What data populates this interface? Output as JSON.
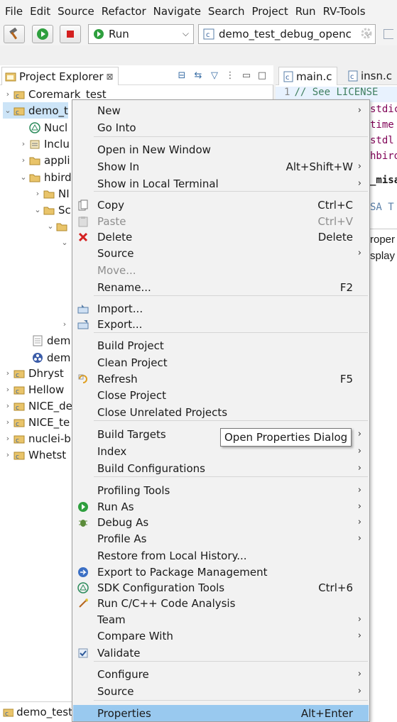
{
  "menubar": [
    "File",
    "Edit",
    "Source",
    "Refactor",
    "Navigate",
    "Search",
    "Project",
    "Run",
    "RV-Tools"
  ],
  "toolbar": {
    "run_mode": "Run",
    "launch_config": "demo_test_debug_openc"
  },
  "explorer": {
    "title": "Project Explorer",
    "close_glyph": "⊠",
    "tree": [
      {
        "label": "Coremark_test"
      },
      {
        "label": "demo_t"
      },
      {
        "label": "Nucl"
      },
      {
        "label": "Inclu"
      },
      {
        "label": "appli"
      },
      {
        "label": "hbird"
      },
      {
        "label": "NI"
      },
      {
        "label": "Sc"
      },
      {
        "label": "dem"
      },
      {
        "label": "dem"
      },
      {
        "label": "Dhryst"
      },
      {
        "label": "Hellow"
      },
      {
        "label": "NICE_de"
      },
      {
        "label": "NICE_te"
      },
      {
        "label": "nuclei-b"
      },
      {
        "label": "Whetst"
      }
    ]
  },
  "editor": {
    "tabs": [
      "main.c",
      "insn.c"
    ],
    "line_number": "1",
    "code_lines": [
      "// See LICENSE",
      "stdic",
      "time",
      "stdl",
      "hbird",
      "_misa",
      "SA T"
    ],
    "panel_lines": [
      "roper",
      "splay"
    ]
  },
  "bottombar": {
    "label": "demo_test"
  },
  "context_menu": {
    "items": [
      {
        "label": "New",
        "accel": "",
        "submenu": true
      },
      {
        "label": "Go Into",
        "accel": ""
      },
      {
        "label": "Open in New Window",
        "accel": ""
      },
      {
        "label": "Show In",
        "accel": "Alt+Shift+W",
        "submenu": true
      },
      {
        "label": "Show in Local Terminal",
        "accel": "",
        "submenu": true
      },
      {
        "label": "Copy",
        "accel": "Ctrl+C"
      },
      {
        "label": "Paste",
        "accel": "Ctrl+V"
      },
      {
        "label": "Delete",
        "accel": "Delete"
      },
      {
        "label": "Source",
        "accel": "",
        "submenu": true
      },
      {
        "label": "Move...",
        "accel": ""
      },
      {
        "label": "Rename...",
        "accel": "F2"
      },
      {
        "label": "Import...",
        "accel": ""
      },
      {
        "label": "Export...",
        "accel": ""
      },
      {
        "label": "Build Project",
        "accel": ""
      },
      {
        "label": "Clean Project",
        "accel": ""
      },
      {
        "label": "Refresh",
        "accel": "F5"
      },
      {
        "label": "Close Project",
        "accel": ""
      },
      {
        "label": "Close Unrelated Projects",
        "accel": ""
      },
      {
        "label": "Build Targets",
        "accel": "",
        "submenu": true
      },
      {
        "label": "Index",
        "accel": "",
        "submenu": true
      },
      {
        "label": "Build Configurations",
        "accel": "",
        "submenu": true
      },
      {
        "label": "Profiling Tools",
        "accel": "",
        "submenu": true
      },
      {
        "label": "Run As",
        "accel": "",
        "submenu": true
      },
      {
        "label": "Debug As",
        "accel": "",
        "submenu": true
      },
      {
        "label": "Profile As",
        "accel": "",
        "submenu": true
      },
      {
        "label": "Restore from Local History...",
        "accel": ""
      },
      {
        "label": "Export to Package Management",
        "accel": ""
      },
      {
        "label": "SDK Configuration Tools",
        "accel": "Ctrl+6"
      },
      {
        "label": "Run C/C++ Code Analysis",
        "accel": ""
      },
      {
        "label": "Team",
        "accel": "",
        "submenu": true
      },
      {
        "label": "Compare With",
        "accel": "",
        "submenu": true
      },
      {
        "label": "Validate",
        "accel": ""
      },
      {
        "label": "Configure",
        "accel": "",
        "submenu": true
      },
      {
        "label": "Source",
        "accel": "",
        "submenu": true
      },
      {
        "label": "Properties",
        "accel": "Alt+Enter"
      }
    ],
    "submenu_glyph": "›",
    "selected_item": "Properties",
    "disabled_items": [
      "Paste",
      "Move..."
    ]
  },
  "tooltip": "Open Properties Dialog",
  "colors": {
    "selection": "#99c9ef",
    "menu_bg": "#f2f2f2",
    "comment_green": "#3f7f5f",
    "keyword_purple": "#7f0055"
  }
}
